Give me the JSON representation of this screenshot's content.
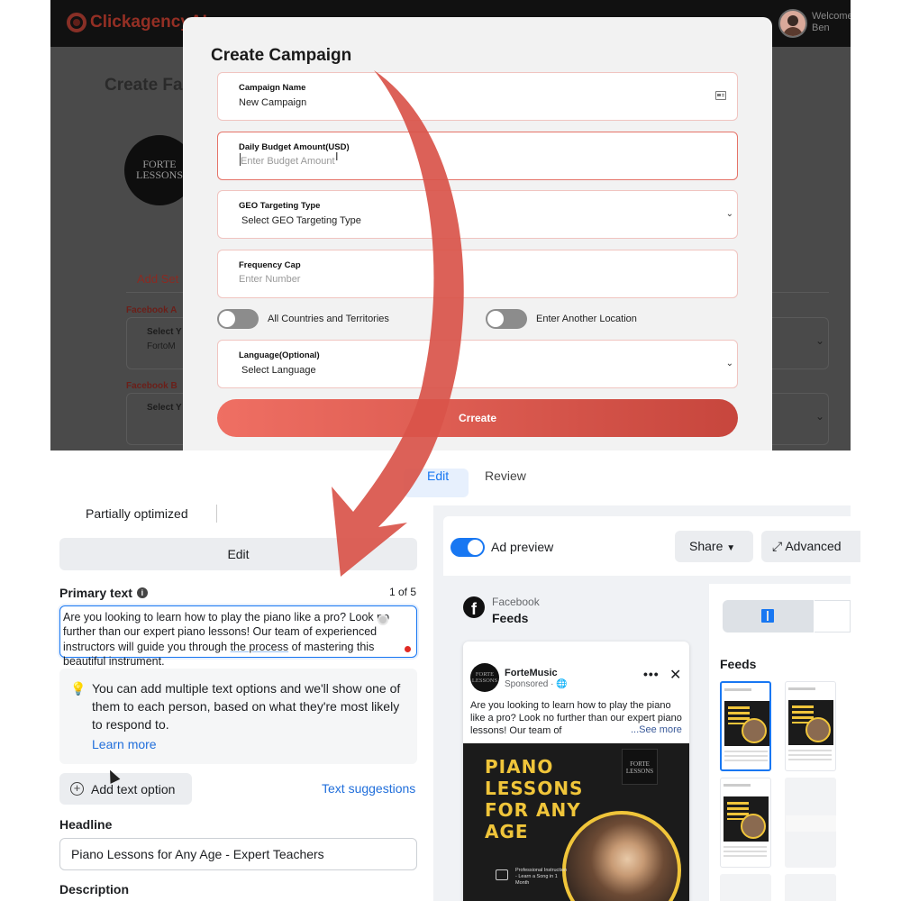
{
  "app": {
    "brand": "ClickagencyAI",
    "welcome": "Welcome",
    "user": "Ben",
    "bg_title": "Create Fa",
    "bg_logo": "FORTE LESSONS",
    "bg_tab": "Add Set",
    "bg_label_1": "Facebook A",
    "bg_select_1": "Select Y",
    "bg_select_1_val": "FortoM",
    "bg_label_2": "Facebook B",
    "bg_select_2": "Select Y"
  },
  "modal": {
    "title": "Create Campaign",
    "campaign_name": {
      "label": "Campaign Name",
      "value": "New Campaign"
    },
    "daily_budget": {
      "label": "Daily Budget Amount(USD)",
      "placeholder": "Enter Budget Amount"
    },
    "geo_targeting": {
      "label": "GEO Targeting Type",
      "value": "Select GEO Targeting Type"
    },
    "frequency_cap": {
      "label": "Frequency Cap",
      "placeholder": "Enter Number"
    },
    "toggle_all_countries": "All Countries and Territories",
    "toggle_another_location": "Enter Another Location",
    "language": {
      "label": "Language(Optional)",
      "value": "Select Language"
    },
    "create_button": "Crreate"
  },
  "ads_manager": {
    "tabs": {
      "edit": "Edit",
      "review": "Review"
    },
    "status": "Partially optimized",
    "edit_button": "Edit",
    "primary_text": {
      "label": "Primary text",
      "count": "1 of 5",
      "text_a": "Are you looking to learn how to play the piano like a pro? Look no further than our expert piano lessons! Our team of experienced instructors will guide you through ",
      "text_b": "the process",
      "text_c": " of mastering this beautiful instrument."
    },
    "tip": "You can add multiple text options and we'll show one of them to each person, based on what they're most likely to respond to.",
    "learn_more": "Learn more",
    "add_text_option": "Add text option",
    "text_suggestions": "Text suggestions",
    "headline": {
      "label": "Headline",
      "value": "Piano Lessons for Any Age - Expert Teachers"
    },
    "description_label": "Description"
  },
  "preview": {
    "ad_preview_label": "Ad preview",
    "ad_preview_on": true,
    "share_button": "Share",
    "advanced_button": "Advanced",
    "platform": "Facebook",
    "placement": "Feeds",
    "feeds_label": "Feeds",
    "post": {
      "page_name": "ForteMusic",
      "sponsored": "Sponsored",
      "text": "Are you looking to learn how to play the piano like a pro? Look no further than our expert piano lessons! Our team of",
      "see_more": "...See more",
      "image_headline": "PIANO LESSONS FOR ANY AGE",
      "image_logo": "FORTE LESSONS",
      "image_small_text": "Professional Instruction - Learn a Song in 1 Month"
    }
  },
  "colors": {
    "accent_red": "#d9544a",
    "meta_blue": "#1877f2",
    "poster_yellow": "#f0c53a"
  }
}
